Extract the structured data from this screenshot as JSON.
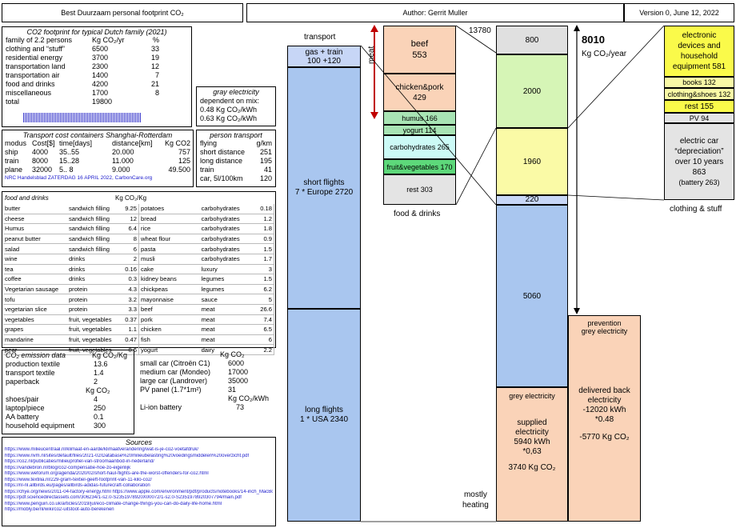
{
  "header": {
    "title": "Best Duurzaam personal footprint CO₂",
    "author": "Author: Gerrit Muller",
    "version": "Version 0, June 12, 2022"
  },
  "family": {
    "title": "CO2 footprint for typical Dutch family (2021)",
    "header": [
      "family of 2.2 persons",
      "Kg CO₂/yr",
      "%"
    ],
    "rows": [
      [
        "clothing and “stuff”",
        "6500",
        "33"
      ],
      [
        "residential energy",
        "3700",
        "19"
      ],
      [
        "transportation land",
        "2300",
        "12"
      ],
      [
        "transportation air",
        "1400",
        "7"
      ],
      [
        "food and drinks",
        "4200",
        "21"
      ],
      [
        "miscellaneous",
        "1700",
        "8"
      ],
      [
        "total",
        "19800",
        ""
      ]
    ]
  },
  "gray": {
    "title": "gray electricity",
    "lines": [
      "dependent on mix:",
      "0.48 Kg CO₂/kWh",
      "0.63 Kg CO₂/kWh"
    ]
  },
  "transport_cost": {
    "title": "Transport cost containers Shanghai-Rotterdam",
    "header": [
      "modus",
      "Cost[$]",
      "time[days]",
      "distance[km]",
      "Kg CO2"
    ],
    "rows": [
      [
        "ship",
        "4000",
        "35..55",
        "20.000",
        "757"
      ],
      [
        "train",
        "8000",
        "15..28",
        "11.000",
        "125"
      ],
      [
        "plane",
        "32000",
        "5.. 8",
        "9.000",
        "49.500"
      ]
    ],
    "source": "NRC Handelsblad ZATERDAG 16 APRIL 2022, CarbonCare.org"
  },
  "person": {
    "title": "person transport",
    "header": [
      "flying",
      "g/km"
    ],
    "rows": [
      [
        "short distance",
        "251"
      ],
      [
        "long distance",
        "195"
      ],
      [
        "train",
        "41"
      ],
      [
        "car, 5l/100km",
        "120"
      ]
    ]
  },
  "food": {
    "title": "food and drinks",
    "unit": "Kg CO₂/Kg",
    "left": [
      [
        "butter",
        "sandwich filling",
        "9.25"
      ],
      [
        "cheese",
        "sandwich filling",
        "12"
      ],
      [
        "Humus",
        "sandwich filling",
        "6.4"
      ],
      [
        "peanut butter",
        "sandwich filling",
        "8"
      ],
      [
        "salad",
        "sandwich filling",
        "6"
      ],
      [
        "wine",
        "drinks",
        "2"
      ],
      [
        "tea",
        "drinks",
        "0.16"
      ],
      [
        "coffee",
        "drinks",
        "0.3"
      ],
      [
        "Vegetarian sausage",
        "protein",
        "4.3"
      ],
      [
        "tofu",
        "protein",
        "3.2"
      ],
      [
        "vegetarian slice",
        "protein",
        "3.3"
      ],
      [
        "vegetables",
        "fruit, vegetables",
        "0.37"
      ],
      [
        "grapes",
        "fruit, vegetables",
        "1.1"
      ],
      [
        "mandarine",
        "fruit, vegetables",
        "0.47"
      ],
      [
        "pear",
        "fruit, vegetables",
        "0.6"
      ]
    ],
    "right": [
      [
        "potatoes",
        "carbohydrates",
        "0.18"
      ],
      [
        "bread",
        "carbohydrates",
        "1.2"
      ],
      [
        "rice",
        "carbohydrates",
        "1.8"
      ],
      [
        "wheat flour",
        "carbohydrates",
        "0.9"
      ],
      [
        "pasta",
        "carbohydrates",
        "1.5"
      ],
      [
        "musli",
        "carbohydrates",
        "1.7"
      ],
      [
        "cake",
        "luxury",
        "3"
      ],
      [
        "kidney beans",
        "legumes",
        "1.5"
      ],
      [
        "chickpeas",
        "legumes",
        "6.2"
      ],
      [
        "mayonnaise",
        "sauce",
        "5"
      ],
      [
        "beef",
        "meat",
        "26.6"
      ],
      [
        "pork",
        "meat",
        "7.4"
      ],
      [
        "chicken",
        "meat",
        "6.5"
      ],
      [
        "fish",
        "meat",
        "6"
      ],
      [
        "yogurt",
        "dairy",
        "2.2"
      ]
    ]
  },
  "emission": {
    "title": "CO₂ emission data",
    "unit1": "Kg CO₂/Kg",
    "rows1": [
      [
        "production textile",
        "13.6"
      ],
      [
        "transport textile",
        "1.4"
      ],
      [
        "paperback",
        "2"
      ]
    ],
    "unit2": "Kg CO₂",
    "rows2": [
      [
        "shoes/pair",
        "4"
      ],
      [
        "laptop/piece",
        "250"
      ],
      [
        "AA battery",
        "0.1"
      ],
      [
        "household equipment",
        "300"
      ]
    ]
  },
  "cars": {
    "unit1": "Kg CO₂",
    "rows1": [
      [
        "small car (Citroën C1)",
        "6000"
      ],
      [
        "medium car (Mondeo)",
        "17000"
      ],
      [
        "large car (Landrover)",
        "35000"
      ],
      [
        "PV panel (1.7*1m²)",
        "31"
      ]
    ],
    "unit2": "Kg CO₂/kWh",
    "rows2": [
      [
        "Li-ion battery",
        "73"
      ]
    ]
  },
  "sources": {
    "title": "Sources",
    "links": [
      "https://www.milieucentraal.nl/klimaat-en-aarde/klimaatverandering/wat-is-je-co2-voetafdruk/",
      "https://www.rivm.nl/sites/default/files/2021-02/Database%20milieubelasting%20voedingsmiddelen%20overzicht.pdf",
      "https://co2.nl/publicaties/milieuprofiel-van-stroomaanbod-in-nederland/",
      "https://vandebron.nl/blog/co2-compensatie-hoe-zo-eigenlijk",
      "https://www.weforum.org/agenda/2020/02/short-haul-flights-are-the-worst-offenders-for-co2.html",
      "https://www.textilia.nl/229-gram-textiel-geeft-footprint-van-11-kilo-co2/",
      "https://nl-nl.allbirds.eu/pages/allbirds-adidas-futurecraft-collaboration",
      "https://chye.org/news/2011-04-factory-energy.html  https://www.apple.com/environment/pdf/products/notebooks/14-inch_MacBook_Pro_PER_Oct2021.pdf",
      "https://pdf.sciencedirectassets.com/306234/1-s2.0-S2351978920X00072/1-s2.0-S2351978920307794/main.pdf",
      "https://www.penguin.co.uk/articles/2019/jul/eco-climate-change-things-you-can-do-daily-life-home.html",
      "https://mobly.be/nl/wiki/co2-uitstoot-auto-berekenen"
    ]
  },
  "transport_col": {
    "label": "transport",
    "gas": "gas + train",
    "gas2": "100 +120",
    "short": "short flights",
    "short2": "7 * Europe 2720",
    "long": "long flights",
    "long2": "1 * USA 2340",
    "mostly": "mostly",
    "heating": "heating"
  },
  "food_col": {
    "label": "food & drinks",
    "meat": "meat",
    "beef": "beef",
    "beef_v": "553",
    "chicken": "chicken&pork",
    "chicken_v": "429",
    "humus": "humus 166",
    "yogurt": "yogurt 114",
    "carbs": "carbohydrates 265",
    "fruit": "fruit&vegetables 170",
    "rest": "rest 303"
  },
  "stack": {
    "top_label": "13780",
    "segs": [
      "800",
      "2000",
      "1960",
      "220",
      "5060"
    ],
    "total": "8010",
    "unit": "Kg CO₂/year"
  },
  "elec": {
    "grey": "grey electricity",
    "supplied": "supplied",
    "electricity": "electricity",
    "kwh": "5940 kWh",
    "factor": "*0,63",
    "co2": "3740 Kg CO₂",
    "prevention": "prevention",
    "grey2": "grey electricity",
    "delivered": "delivered back",
    "electricity2": "electricity",
    "kwh2": "-12020 kWh",
    "factor2": "*0.48",
    "co2b": "-5770 Kg CO₂"
  },
  "stuff": {
    "devices": [
      "electronic",
      "devices and",
      "household",
      "equipment 581"
    ],
    "books": "books 132",
    "clothing": "clothing&shoes 132",
    "rest": "rest 155",
    "pv": "PV 94",
    "car": [
      "electric car",
      "“depreciation”",
      "over 10 years",
      "863"
    ],
    "battery": "(battery 263)",
    "label": "clothing & stuff"
  }
}
